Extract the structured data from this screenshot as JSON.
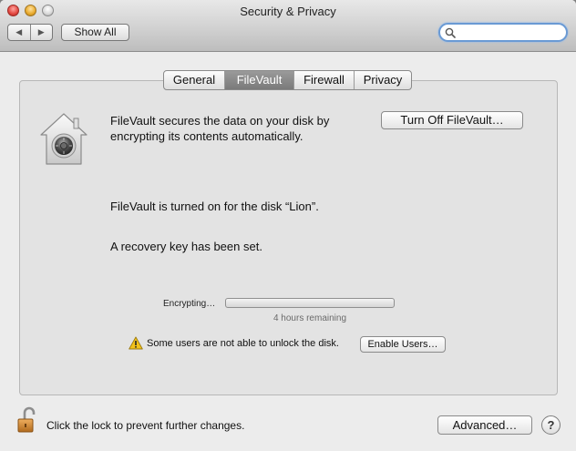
{
  "window": {
    "title": "Security & Privacy",
    "back_glyph": "◀",
    "forward_glyph": "▶",
    "show_all": "Show All",
    "search_placeholder": ""
  },
  "tabs": [
    {
      "label": "General",
      "active": false
    },
    {
      "label": "FileVault",
      "active": true
    },
    {
      "label": "Firewall",
      "active": false
    },
    {
      "label": "Privacy",
      "active": false
    }
  ],
  "filevault": {
    "description_line1": "FileVault secures the data on your disk by",
    "description_line2": "encrypting its contents automatically.",
    "turn_off_button": "Turn Off FileVault…",
    "status": "FileVault is turned on for the disk “Lion”.",
    "recovery_key": "A recovery key has been set.",
    "progress_label": "Encrypting…",
    "progress_fraction": 0.0,
    "time_remaining": "4 hours remaining",
    "warning": "Some users are not able to unlock the disk.",
    "enable_users_button": "Enable Users…"
  },
  "footer": {
    "lock_text": "Click the lock to prevent further changes.",
    "advanced_button": "Advanced…",
    "help_label": "?"
  },
  "icons": {
    "filevault": "house-safe-icon",
    "warning": "warning-triangle-icon",
    "lock": "open-lock-icon",
    "search": "magnifier-icon"
  },
  "colors": {
    "window_bg": "#ececec",
    "panel_bg": "#e3e3e3",
    "active_tab": "#858585",
    "search_focus": "#6a9ad4",
    "warning_yellow": "#f2c21a",
    "lock_orange": "#d9892c"
  }
}
